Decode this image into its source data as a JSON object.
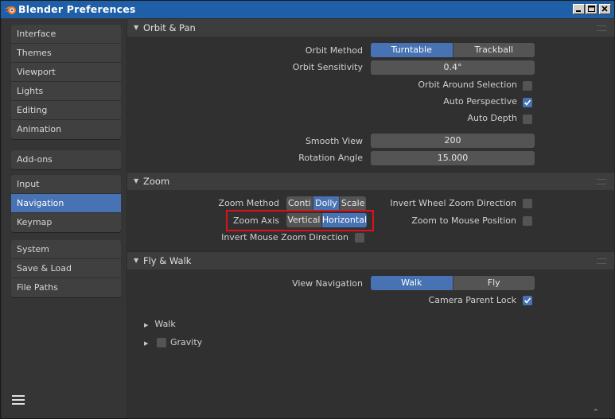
{
  "window": {
    "title": "Blender Preferences",
    "accent_color": "#4772b3"
  },
  "sidebar": {
    "groups": [
      {
        "items": [
          "Interface",
          "Themes",
          "Viewport",
          "Lights",
          "Editing",
          "Animation"
        ]
      },
      {
        "items": [
          "Add-ons"
        ]
      },
      {
        "items": [
          "Input",
          "Navigation",
          "Keymap"
        ]
      },
      {
        "items": [
          "System",
          "Save & Load",
          "File Paths"
        ]
      }
    ],
    "active_item": "Navigation",
    "menu_icon": "hamburger-icon"
  },
  "orbit_pan": {
    "title": "Orbit & Pan",
    "orbit_method_label": "Orbit Method",
    "orbit_method_options": [
      "Turntable",
      "Trackball"
    ],
    "orbit_method_selected": "Turntable",
    "orbit_sensitivity_label": "Orbit Sensitivity",
    "orbit_sensitivity_value": "0.4°",
    "orbit_around_selection_label": "Orbit Around Selection",
    "orbit_around_selection_checked": false,
    "auto_perspective_label": "Auto Perspective",
    "auto_perspective_checked": true,
    "auto_depth_label": "Auto Depth",
    "auto_depth_checked": false,
    "smooth_view_label": "Smooth View",
    "smooth_view_value": "200",
    "rotation_angle_label": "Rotation Angle",
    "rotation_angle_value": "15.000"
  },
  "zoom": {
    "title": "Zoom",
    "zoom_method_label": "Zoom Method",
    "zoom_method_options": [
      "Conti",
      "Dolly",
      "Scale"
    ],
    "zoom_method_selected": "Dolly",
    "zoom_axis_label": "Zoom Axis",
    "zoom_axis_options": [
      "Vertical",
      "Horizontal"
    ],
    "zoom_axis_selected": "Horizontal",
    "invert_mouse_zoom_label": "Invert Mouse Zoom Direction",
    "invert_mouse_zoom_checked": false,
    "invert_wheel_zoom_label": "Invert Wheel Zoom Direction",
    "invert_wheel_zoom_checked": false,
    "zoom_to_mouse_label": "Zoom to Mouse Position",
    "zoom_to_mouse_checked": false
  },
  "fly_walk": {
    "title": "Fly & Walk",
    "view_navigation_label": "View Navigation",
    "view_navigation_options": [
      "Walk",
      "Fly"
    ],
    "view_navigation_selected": "Walk",
    "camera_parent_lock_label": "Camera Parent Lock",
    "camera_parent_lock_checked": true,
    "walk_subpanel_label": "Walk",
    "gravity_subpanel_label": "Gravity",
    "gravity_checked": false
  }
}
